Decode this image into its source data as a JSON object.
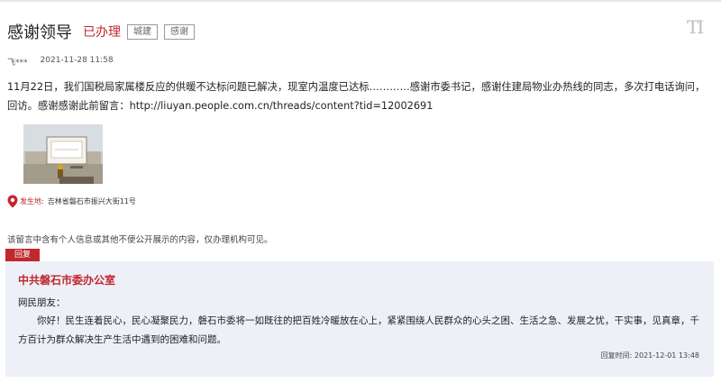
{
  "header": {
    "title": "感谢领导",
    "status": "已办理",
    "tags": [
      "城建",
      "感谢"
    ],
    "font_toggle": "TI"
  },
  "meta": {
    "author": "飞***",
    "datetime": "2021-11-28 11:58"
  },
  "message": {
    "content": "11月22日，我们国税局家属楼反应的供暖不达标问题已解决，现室内温度已达标…………感谢市委书记，感谢住建局物业办热线的同志，多次打电话询问，回访。感谢感谢此前留言：http://liuyan.people.com.cn/threads/content?tid=12002691"
  },
  "location": {
    "label": "发生地:",
    "value": "吉林省磐石市振兴大街11号"
  },
  "privacy_notice": "该留言中含有个人信息或其他不便公开展示的内容，仅办理机构可见。",
  "reply": {
    "tab_label": "回复",
    "org": "中共磐石市委办公室",
    "greeting": "网民朋友：",
    "body": "你好！民生连着民心，民心凝聚民力，磐石市委将一如既往的把百姓冷暖放在心上，紧紧围绕人民群众的心头之困、生活之急、发展之忧，干实事，见真章，千方百计为群众解决生产生活中遇到的困难和问题。",
    "time_label": "回复时间:",
    "time": "2021-12-01 13:48"
  },
  "colors": {
    "accent_red": "#c0282d",
    "reply_background": "#eef0f8"
  },
  "icons": {
    "location": "map-pin-icon",
    "font_toggle": "font-size-toggle-icon"
  }
}
